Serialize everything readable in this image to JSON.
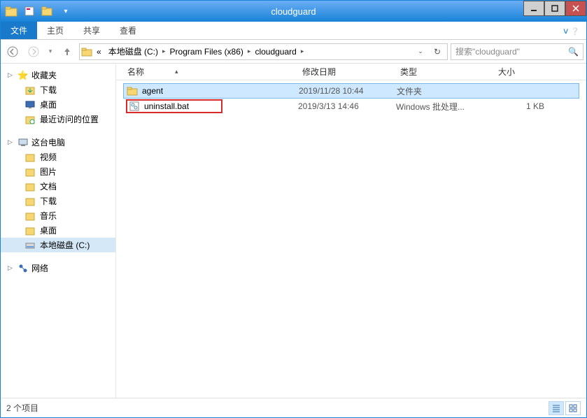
{
  "window": {
    "title": "cloudguard"
  },
  "tabs": {
    "file": "文件",
    "home": "主页",
    "share": "共享",
    "view": "查看"
  },
  "breadcrumb": {
    "prefix": "«",
    "segments": [
      "本地磁盘 (C:)",
      "Program Files (x86)",
      "cloudguard"
    ]
  },
  "search": {
    "placeholder": "搜索\"cloudguard\""
  },
  "columns": {
    "name": "名称",
    "date": "修改日期",
    "type": "类型",
    "size": "大小"
  },
  "files": [
    {
      "name": "agent",
      "date": "2019/11/28 10:44",
      "type": "文件夹",
      "size": "",
      "icon": "folder",
      "selected": true,
      "highlighted": false
    },
    {
      "name": "uninstall.bat",
      "date": "2019/3/13 14:46",
      "type": "Windows 批处理...",
      "size": "1 KB",
      "icon": "bat",
      "selected": false,
      "highlighted": true
    }
  ],
  "sidebar": {
    "favorites": {
      "label": "收藏夹",
      "items": [
        {
          "label": "下载",
          "icon": "download"
        },
        {
          "label": "桌面",
          "icon": "desktop"
        },
        {
          "label": "最近访问的位置",
          "icon": "recent"
        }
      ]
    },
    "thispc": {
      "label": "这台电脑",
      "items": [
        {
          "label": "视频",
          "icon": "video"
        },
        {
          "label": "图片",
          "icon": "pictures"
        },
        {
          "label": "文档",
          "icon": "documents"
        },
        {
          "label": "下载",
          "icon": "download"
        },
        {
          "label": "音乐",
          "icon": "music"
        },
        {
          "label": "桌面",
          "icon": "desktop"
        },
        {
          "label": "本地磁盘 (C:)",
          "icon": "drive",
          "selected": true
        }
      ]
    },
    "network": {
      "label": "网络"
    }
  },
  "status": {
    "count": "2 个项目"
  }
}
